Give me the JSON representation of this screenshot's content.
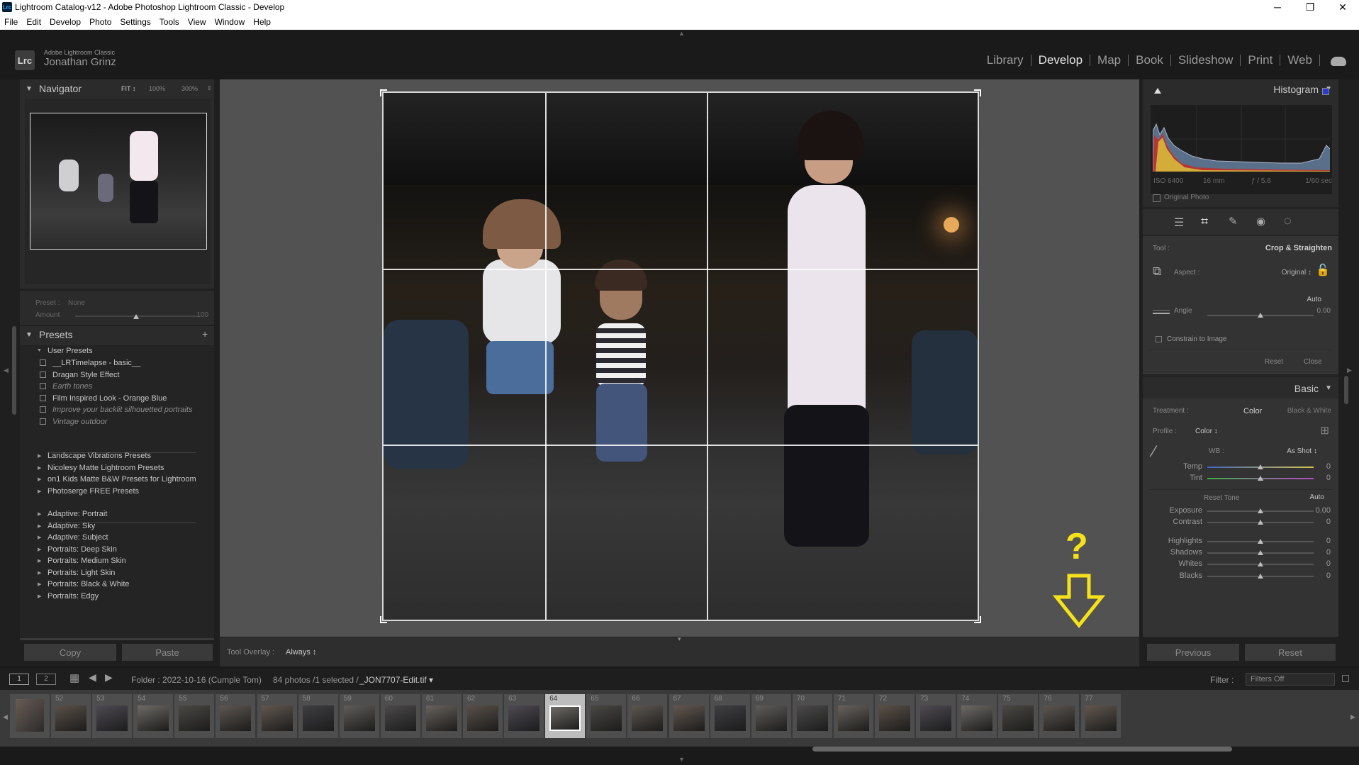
{
  "window": {
    "title": "Lightroom Catalog-v12 - Adobe Photoshop Lightroom Classic - Develop",
    "app_icon": "Lrc"
  },
  "menu": [
    "File",
    "Edit",
    "Develop",
    "Photo",
    "Settings",
    "Tools",
    "View",
    "Window",
    "Help"
  ],
  "header": {
    "logo": "Lrc",
    "app_name": "Adobe Lightroom Classic",
    "user": "Jonathan Grinz"
  },
  "modules": [
    {
      "label": "Library",
      "active": false
    },
    {
      "label": "Develop",
      "active": true
    },
    {
      "label": "Map",
      "active": false
    },
    {
      "label": "Book",
      "active": false
    },
    {
      "label": "Slideshow",
      "active": false
    },
    {
      "label": "Print",
      "active": false
    },
    {
      "label": "Web",
      "active": false
    }
  ],
  "navigator": {
    "title": "Navigator",
    "zoom_fit": "FIT ↕",
    "zoom_100": "100%",
    "zoom_300": "300%"
  },
  "preset_amount": {
    "preset_label": "Preset :",
    "preset_value": "None",
    "amount_label": "Amount",
    "amount_value": "100",
    "amount_fraction": 0.5
  },
  "presets": {
    "title": "Presets",
    "user_group": "User Presets",
    "user_items": [
      {
        "label": "__LRTimelapse - basic__",
        "dim": false
      },
      {
        "label": "Dragan Style Effect",
        "dim": false
      },
      {
        "label": "Earth tones",
        "dim": true
      },
      {
        "label": "Film Inspired Look - Orange Blue",
        "dim": false
      },
      {
        "label": "Improve your backlit silhouetted portraits",
        "dim": true
      },
      {
        "label": "Vintage outdoor",
        "dim": true
      }
    ],
    "groups_a": [
      "Landscape Vibrations Presets",
      "Nicolesy Matte Lightroom Presets",
      "on1 Kids Matte B&W Presets for Lightroom",
      "Photoserge FREE Presets"
    ],
    "groups_b": [
      "Adaptive: Portrait",
      "Adaptive: Sky",
      "Adaptive: Subject",
      "Portraits: Deep Skin",
      "Portraits: Medium Skin",
      "Portraits: Light Skin",
      "Portraits: Black & White",
      "Portraits: Edgy"
    ]
  },
  "left_buttons": {
    "copy": "Copy",
    "paste": "Paste"
  },
  "toolbar": {
    "overlay_label": "Tool Overlay :",
    "overlay_value": "Always ↕"
  },
  "annotation": {
    "mark": "?",
    "color": "#f5e21b"
  },
  "histogram": {
    "title": "Histogram",
    "iso": "ISO 6400",
    "focal": "16 mm",
    "aperture": "ƒ / 5.6",
    "shutter": "1/60 sec",
    "original_photo": "Original Photo"
  },
  "crop": {
    "tool_label": "Tool :",
    "tool_value": "Crop & Straighten",
    "aspect_label": "Aspect :",
    "aspect_value": "Original ↕",
    "auto": "Auto",
    "angle_label": "Angle",
    "angle_value": "0.00",
    "angle_fraction": 0.5,
    "constrain": "Constrain to Image",
    "reset": "Reset",
    "close": "Close"
  },
  "basic": {
    "title": "Basic",
    "treatment_label": "Treatment :",
    "treatment_color": "Color",
    "treatment_bw": "Black & White",
    "profile_label": "Profile :",
    "profile_value": "Color ↕",
    "wb_label": "WB :",
    "wb_value": "As Shot ↕",
    "temp_label": "Temp",
    "temp_value": "0",
    "tint_label": "Tint",
    "tint_value": "0",
    "reset_tone": "Reset Tone",
    "tone_auto": "Auto",
    "sliders": [
      {
        "label": "Exposure",
        "value": "0.00"
      },
      {
        "label": "Contrast",
        "value": "0"
      },
      {
        "label": "Highlights",
        "value": "0"
      },
      {
        "label": "Shadows",
        "value": "0"
      },
      {
        "label": "Whites",
        "value": "0"
      },
      {
        "label": "Blacks",
        "value": "0"
      }
    ]
  },
  "right_buttons": {
    "previous": "Previous",
    "reset": "Reset"
  },
  "filmbar": {
    "view1": "1",
    "view2": "2",
    "folder": "Folder : 2022-10-16 (Cumple Tom)",
    "count": "84 photos /1 selected /",
    "file": "_JON7707-Edit.tif ▾",
    "filter_label": "Filter :",
    "filter_value": "Filters Off"
  },
  "filmstrip": {
    "numbers": [
      "52",
      "53",
      "54",
      "55",
      "56",
      "57",
      "58",
      "59",
      "60",
      "61",
      "62",
      "63",
      "64",
      "65",
      "66",
      "67",
      "68",
      "69",
      "70",
      "71",
      "72",
      "73",
      "74",
      "75",
      "76",
      "77"
    ],
    "selected": "64"
  }
}
